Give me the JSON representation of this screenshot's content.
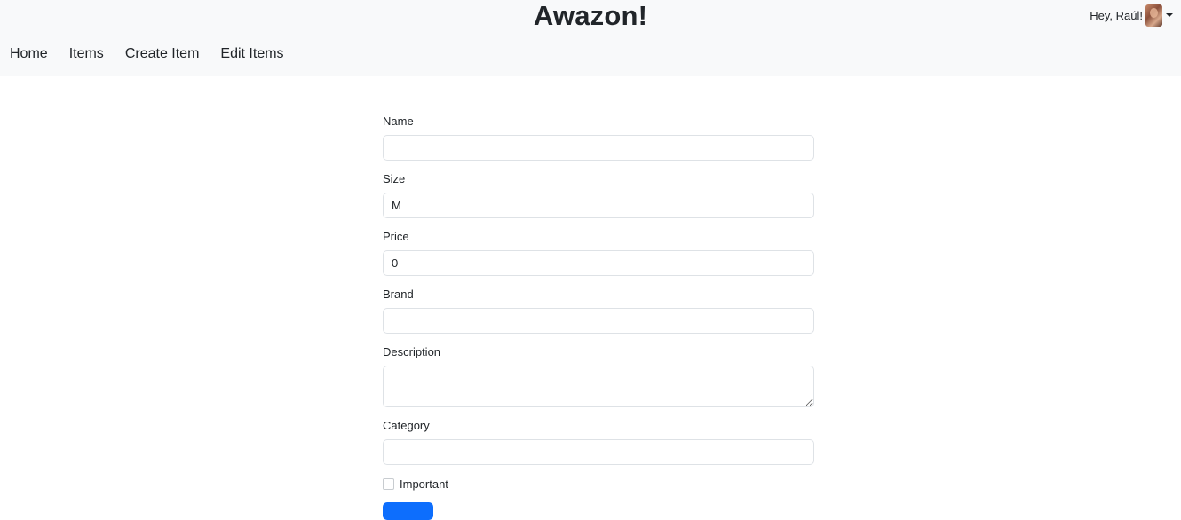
{
  "header": {
    "brand": "Awazon!",
    "user_greeting": "Hey, Raúl!",
    "nav": [
      "Home",
      "Items",
      "Create Item",
      "Edit Items"
    ]
  },
  "form": {
    "name": {
      "label": "Name",
      "value": ""
    },
    "size": {
      "label": "Size",
      "value": "M"
    },
    "price": {
      "label": "Price",
      "value": "0"
    },
    "brand": {
      "label": "Brand",
      "value": ""
    },
    "description": {
      "label": "Description",
      "value": ""
    },
    "category": {
      "label": "Category",
      "value": ""
    },
    "important": {
      "label": "Important",
      "checked": false
    }
  },
  "colors": {
    "navbar_bg": "#f8f9fa",
    "primary": "#0d6efd"
  },
  "icons": {
    "avatar": "user-avatar-image",
    "dropdown": "caret-down-icon"
  }
}
